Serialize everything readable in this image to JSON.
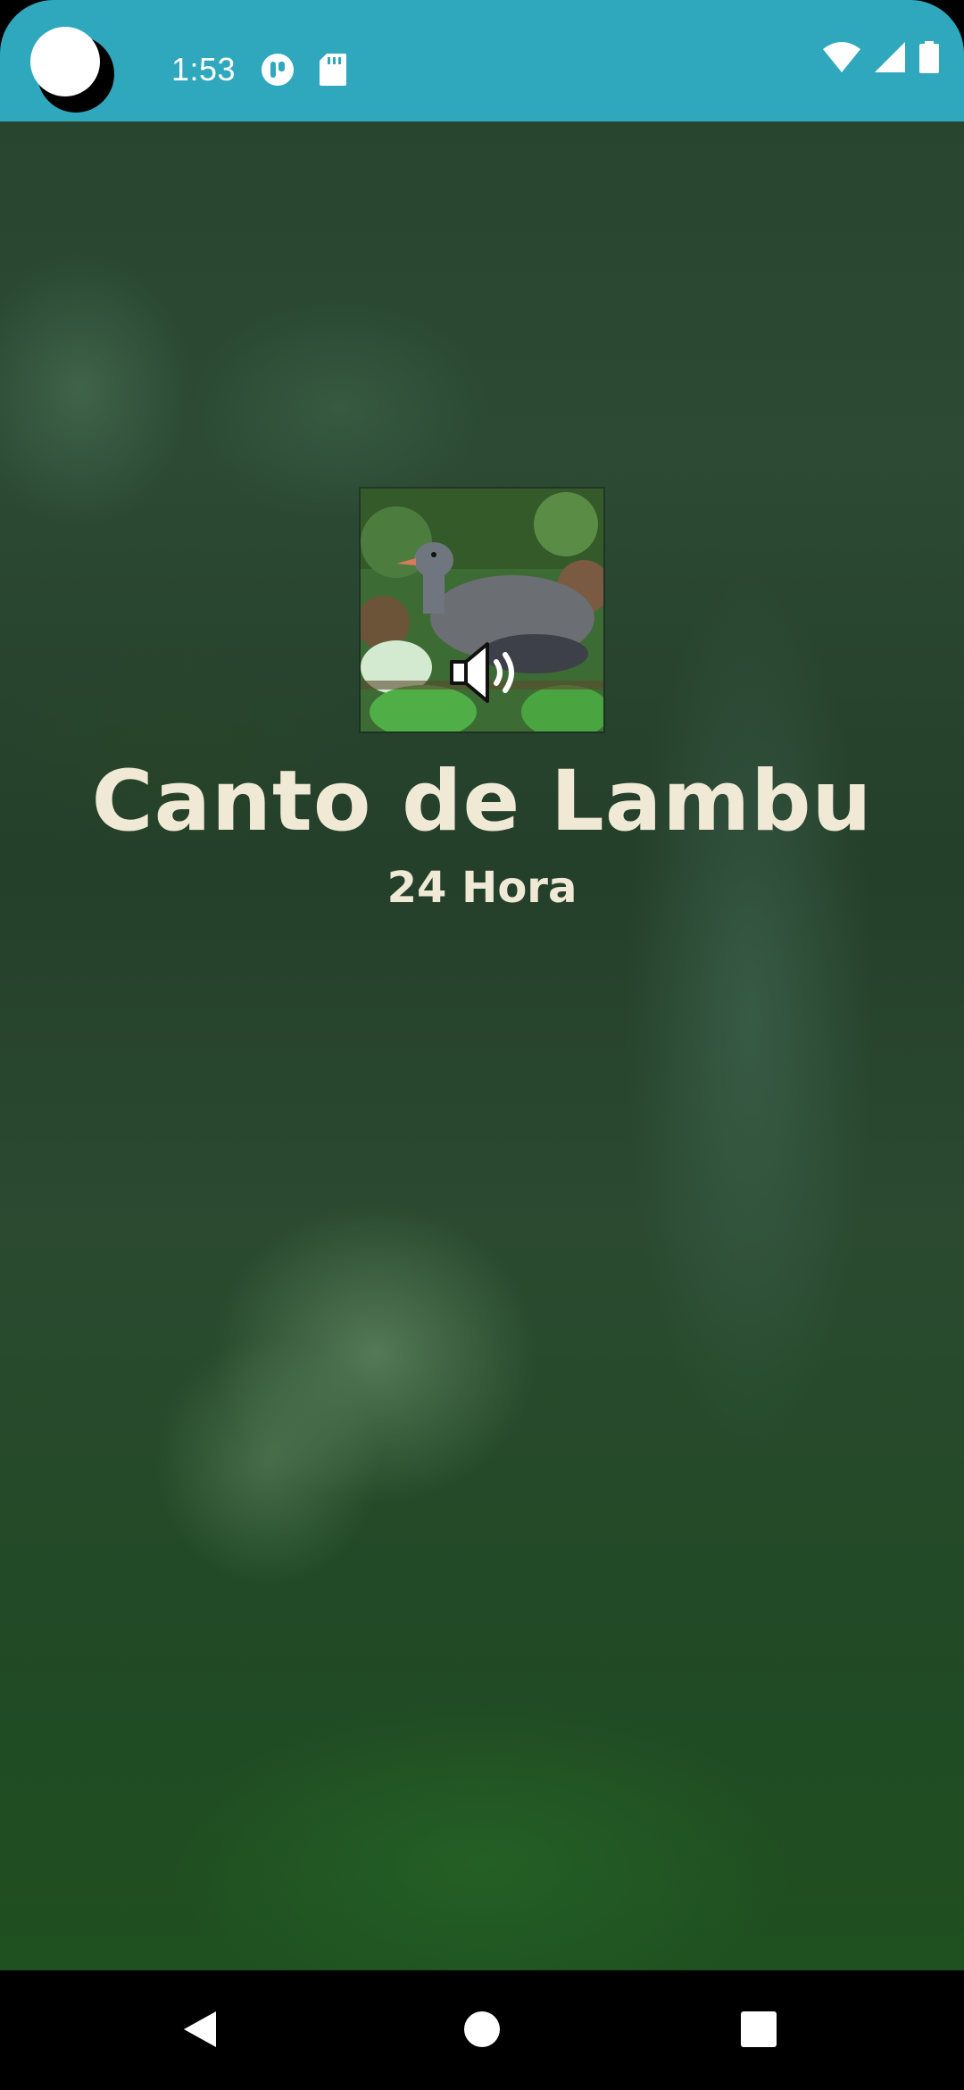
{
  "status_bar": {
    "time": "1:53",
    "left_icons": [
      "app-moon-icon",
      "toggle-icon",
      "sd-card-icon"
    ],
    "right_icons": [
      "wifi-icon",
      "cell-signal-icon",
      "battery-icon"
    ],
    "background_color": "#2fa8bd"
  },
  "main": {
    "thumbnail": {
      "alt": "bird-photo",
      "overlay_icon": "speaker-icon"
    },
    "title": "Canto de Lambu",
    "subtitle": "24 Hora",
    "text_color": "#efe9d6"
  },
  "nav_bar": {
    "buttons": [
      "back-icon",
      "home-icon",
      "recents-icon"
    ]
  }
}
